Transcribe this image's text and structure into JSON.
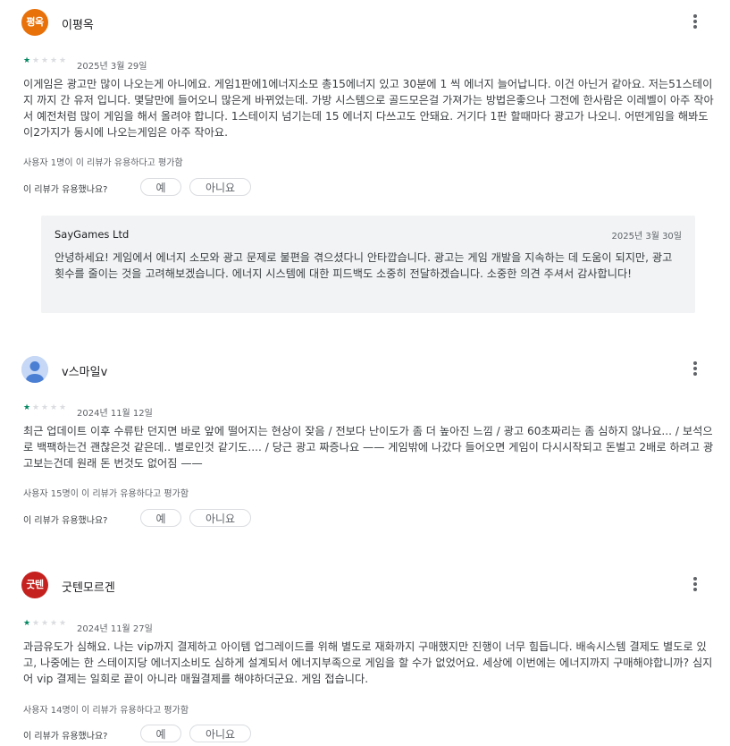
{
  "labels": {
    "helpful_question": "이 리뷰가 유용했나요?",
    "yes": "예",
    "no": "아니요"
  },
  "colors": {
    "star_on": "#01875f",
    "star_off": "#dadce0",
    "avatar_orange": "#e8710a",
    "avatar_red": "#c5221f"
  },
  "reviews": [
    {
      "author": "이평옥",
      "avatar_text": "평옥",
      "rating": 1,
      "date": "2025년 3월 29일",
      "body": "이게임은 광고만 많이 나오는게 아니에요. 게임1판에1에너지소모 총15에너지 있고 30분에 1 씩 에너지 늘어납니다. 이건 아닌거 같아요. 저는51스테이지 까지 간 유저 입니다. 몇달만에 들어오니 많은게 바뀌었는데. 가방 시스템으로 골드모은걸 가져가는 방법은좋으나 그전에 한사람은 이레벨이 아주 작아서 예전처럼 많이 게임을 해서 올려야 합니다. 1스테이지 넘기는데 15 에너지 다쓰고도 안돼요. 거기다 1판 할때마다 광고가 나오니. 어떤게임을 해봐도 이2가지가 동시에 나오는게임은 아주 작아요.",
      "helpful_count": "사용자 1명이 이 리뷰가 유용하다고 평가함",
      "reply": {
        "developer": "SayGames Ltd",
        "date": "2025년 3월 30일",
        "text": "안녕하세요! 게임에서 에너지 소모와 광고 문제로 불편을 겪으셨다니 안타깝습니다. 광고는 게임 개발을 지속하는 데 도움이 되지만, 광고 횟수를 줄이는 것을 고려해보겠습니다. 에너지 시스템에 대한 피드백도 소중히 전달하겠습니다. 소중한 의견 주셔서 감사합니다!"
      }
    },
    {
      "author": "v스마일v",
      "avatar_text": "",
      "rating": 1,
      "date": "2024년 11월 12일",
      "body": "최근 업데이트 이후 수류탄 던지면 바로 앞에 떨어지는 현상이 잦음 / 전보다 난이도가 좀 더 높아진 느낌 / 광고 60초짜리는 좀 심하지 않나요... / 보석으로 백팩하는건 괜찮은것 같은데.. 별로인것 같기도.... / 당근 광고 짜증나요 —— 게임밖에 나갔다 들어오면 게임이 다시시작되고 돈벌고 2배로 하려고 광고보는건데 원래 돈 번것도 없어짐 ——",
      "helpful_count": "사용자 15명이 이 리뷰가 유용하다고 평가함"
    },
    {
      "author": "굿텐모르겐",
      "avatar_text": "굿텐",
      "rating": 1,
      "date": "2024년 11월 27일",
      "body": "과금유도가 심해요. 나는 vip까지 결제하고 아이템 업그레이드를 위해 별도로 재화까지 구매했지만 진행이 너무 힘듭니다. 배속시스템 결제도 별도로 있고, 나중에는 한 스테이지당 에너지소비도 심하게 설계되서 에너지부족으로 게임을 할 수가 없었어요. 세상에 이번에는 에너지까지 구매해야합니까? 심지어 vip 결제는 일회로 끝이 아니라 매월결제를 해야하더군요. 게임 접습니다.",
      "helpful_count": "사용자 14명이 이 리뷰가 유용하다고 평가함"
    }
  ]
}
